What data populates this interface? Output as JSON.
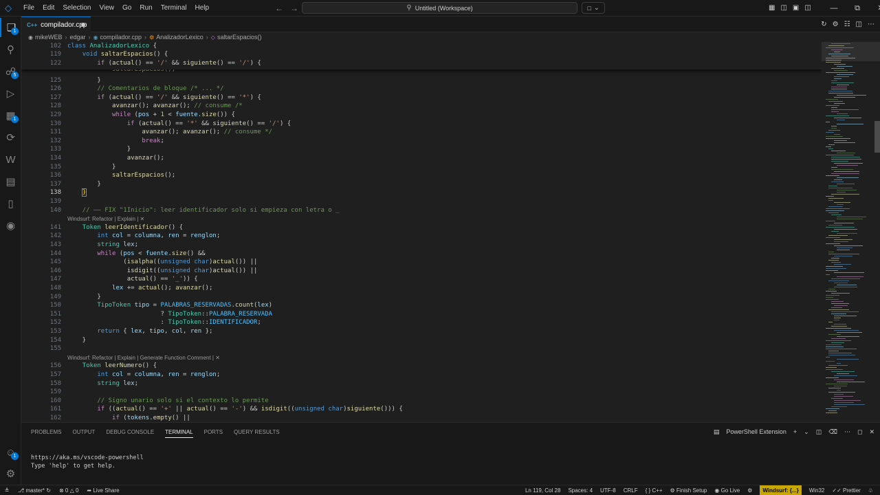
{
  "titlebar": {
    "menu": [
      "File",
      "Edit",
      "Selection",
      "View",
      "Go",
      "Run",
      "Terminal",
      "Help"
    ],
    "search_text": "Untitled (Workspace)"
  },
  "tab": {
    "label": "compilador.cpp",
    "icon": "C++"
  },
  "breadcrumb": [
    "mikeWEB",
    "edgar",
    "compilador.cpp",
    "AnalizadorLexico",
    "saltarEspacios()"
  ],
  "editor": {
    "sticky_lines": [
      {
        "n": "102",
        "text": "class AnalizadorLexico {"
      },
      {
        "n": "119",
        "text": "    void saltarEspacios() {"
      },
      {
        "n": "122",
        "text": "        if (actual() == '/' && siguiente() == '/') {"
      }
    ],
    "partial_line": "            saltarEspacios();",
    "lines": [
      {
        "n": "125",
        "text": "        }"
      },
      {
        "n": "126",
        "text": "        // Comentarios de bloque /* ... */"
      },
      {
        "n": "127",
        "text": "        if (actual() == '/' && siguiente() == '*') {"
      },
      {
        "n": "128",
        "text": "            avanzar(); avanzar(); // consume /*"
      },
      {
        "n": "129",
        "text": "            while (pos + 1 < fuente.size()) {"
      },
      {
        "n": "130",
        "text": "                if (actual() == '*' && siguiente() == '/') {"
      },
      {
        "n": "131",
        "text": "                    avanzar(); avanzar(); // consume */"
      },
      {
        "n": "132",
        "text": "                    break;"
      },
      {
        "n": "133",
        "text": "                }"
      },
      {
        "n": "134",
        "text": "                avanzar();"
      },
      {
        "n": "135",
        "text": "            }"
      },
      {
        "n": "136",
        "text": "            saltarEspacios();"
      },
      {
        "n": "137",
        "text": "        }"
      },
      {
        "n": "138",
        "text": "    }"
      },
      {
        "n": "139",
        "text": ""
      },
      {
        "n": "140",
        "text": "    // —— FIX \"1Inicio\": leer identificador solo si empieza con letra o _"
      },
      {
        "lens": "Windsurf: Refactor | Explain | ✕"
      },
      {
        "n": "141",
        "text": "    Token leerIdentificador() {"
      },
      {
        "n": "142",
        "text": "        int col = columna, ren = renglon;"
      },
      {
        "n": "143",
        "text": "        string lex;"
      },
      {
        "n": "144",
        "text": "        while (pos < fuente.size() &&"
      },
      {
        "n": "145",
        "text": "               (isalpha((unsigned char)actual()) ||"
      },
      {
        "n": "146",
        "text": "                isdigit((unsigned char)actual()) ||"
      },
      {
        "n": "147",
        "text": "                actual() == '_')) {"
      },
      {
        "n": "148",
        "text": "            lex += actual(); avanzar();"
      },
      {
        "n": "149",
        "text": "        }"
      },
      {
        "n": "150",
        "text": "        TipoToken tipo = PALABRAS_RESERVADAS.count(lex)"
      },
      {
        "n": "151",
        "text": "                         ? TipoToken::PALABRA_RESERVADA"
      },
      {
        "n": "152",
        "text": "                         : TipoToken::IDENTIFICADOR;"
      },
      {
        "n": "153",
        "text": "        return { lex, tipo, col, ren };"
      },
      {
        "n": "154",
        "text": "    }"
      },
      {
        "n": "155",
        "text": ""
      },
      {
        "lens": "Windsurf: Refactor | Explain | Generate Function Comment | ✕"
      },
      {
        "n": "156",
        "text": "    Token leerNumero() {"
      },
      {
        "n": "157",
        "text": "        int col = columna, ren = renglon;"
      },
      {
        "n": "158",
        "text": "        string lex;"
      },
      {
        "n": "159",
        "text": ""
      },
      {
        "n": "160",
        "text": "        // Signo unario solo si el contexto lo permite"
      },
      {
        "n": "161",
        "text": "        if ((actual() == '+' || actual() == '-') && isdigit((unsigned char)siguiente())) {"
      },
      {
        "n": "162",
        "text": "            if (tokens.empty() ||"
      }
    ]
  },
  "panel": {
    "tabs": [
      "PROBLEMS",
      "OUTPUT",
      "DEBUG CONSOLE",
      "TERMINAL",
      "PORTS",
      "QUERY RESULTS"
    ],
    "active_tab": "TERMINAL",
    "terminal_name": "PowerShell Extension",
    "terminal_lines": [
      "https://aka.ms/vscode-powershell",
      "Type 'help' to get help."
    ]
  },
  "statusbar": {
    "branch": "master*",
    "problems": "0",
    "warnings": "0",
    "live_share": "Live Share",
    "position": "Ln 119, Col 28",
    "spaces": "Spaces: 4",
    "encoding": "UTF-8",
    "eol": "CRLF",
    "language": "C++",
    "finish_setup": "Finish Setup",
    "go_live": "Go Live",
    "windsurf": "Windsurf: {...}",
    "platform": "Win32",
    "prettier": "Prettier"
  },
  "colors": {
    "accent": "#0078d4",
    "keyword": "#569cd6",
    "control": "#c586c0",
    "type": "#4ec9b0",
    "function": "#dcdcaa",
    "string": "#ce9178",
    "comment": "#6a9955",
    "windsurf_badge": "#c8a800"
  }
}
